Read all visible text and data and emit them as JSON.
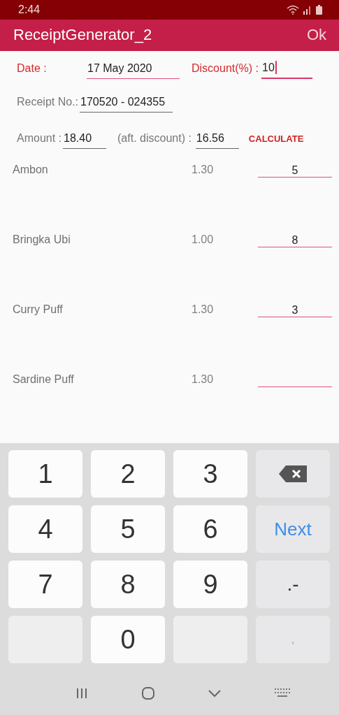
{
  "status_bar": {
    "time": "2:44"
  },
  "app_bar": {
    "title": "ReceiptGenerator_2",
    "action": "Ok"
  },
  "form": {
    "date_label": "Date :",
    "date": "17 May 2020",
    "discount_label": "Discount(%) :",
    "discount": "10",
    "discount_focused": true,
    "receipt_label": "Receipt No.:",
    "receipt_no": "170520 - 024355",
    "amount_label": "Amount :",
    "amount": "18.40",
    "after_label": "(aft. discount) :",
    "after_amount": "16.56",
    "calculate": "CALCULATE"
  },
  "items": [
    {
      "name": "Ambon",
      "price": "1.30",
      "quantity": "5"
    },
    {
      "name": "Bringka Ubi",
      "price": "1.00",
      "quantity": "8"
    },
    {
      "name": "Curry Puff",
      "price": "1.30",
      "quantity": "3"
    },
    {
      "name": "Sardine Puff",
      "price": "1.30"
    }
  ],
  "keyboard": [
    {
      "kind": "digit",
      "label": "1"
    },
    {
      "kind": "digit",
      "label": "2"
    },
    {
      "kind": "digit",
      "label": "3"
    },
    {
      "kind": "backspace"
    },
    {
      "kind": "digit",
      "label": "4"
    },
    {
      "kind": "digit",
      "label": "5"
    },
    {
      "kind": "digit",
      "label": "6"
    },
    {
      "kind": "action",
      "label": "Next"
    },
    {
      "kind": "digit",
      "label": "7"
    },
    {
      "kind": "digit",
      "label": "8"
    },
    {
      "kind": "digit",
      "label": "9"
    },
    {
      "kind": "symbol",
      "label": ".-"
    },
    {
      "kind": "blank"
    },
    {
      "kind": "digit",
      "label": "0"
    },
    {
      "kind": "blank"
    },
    {
      "kind": "comma",
      "label": ","
    }
  ]
}
